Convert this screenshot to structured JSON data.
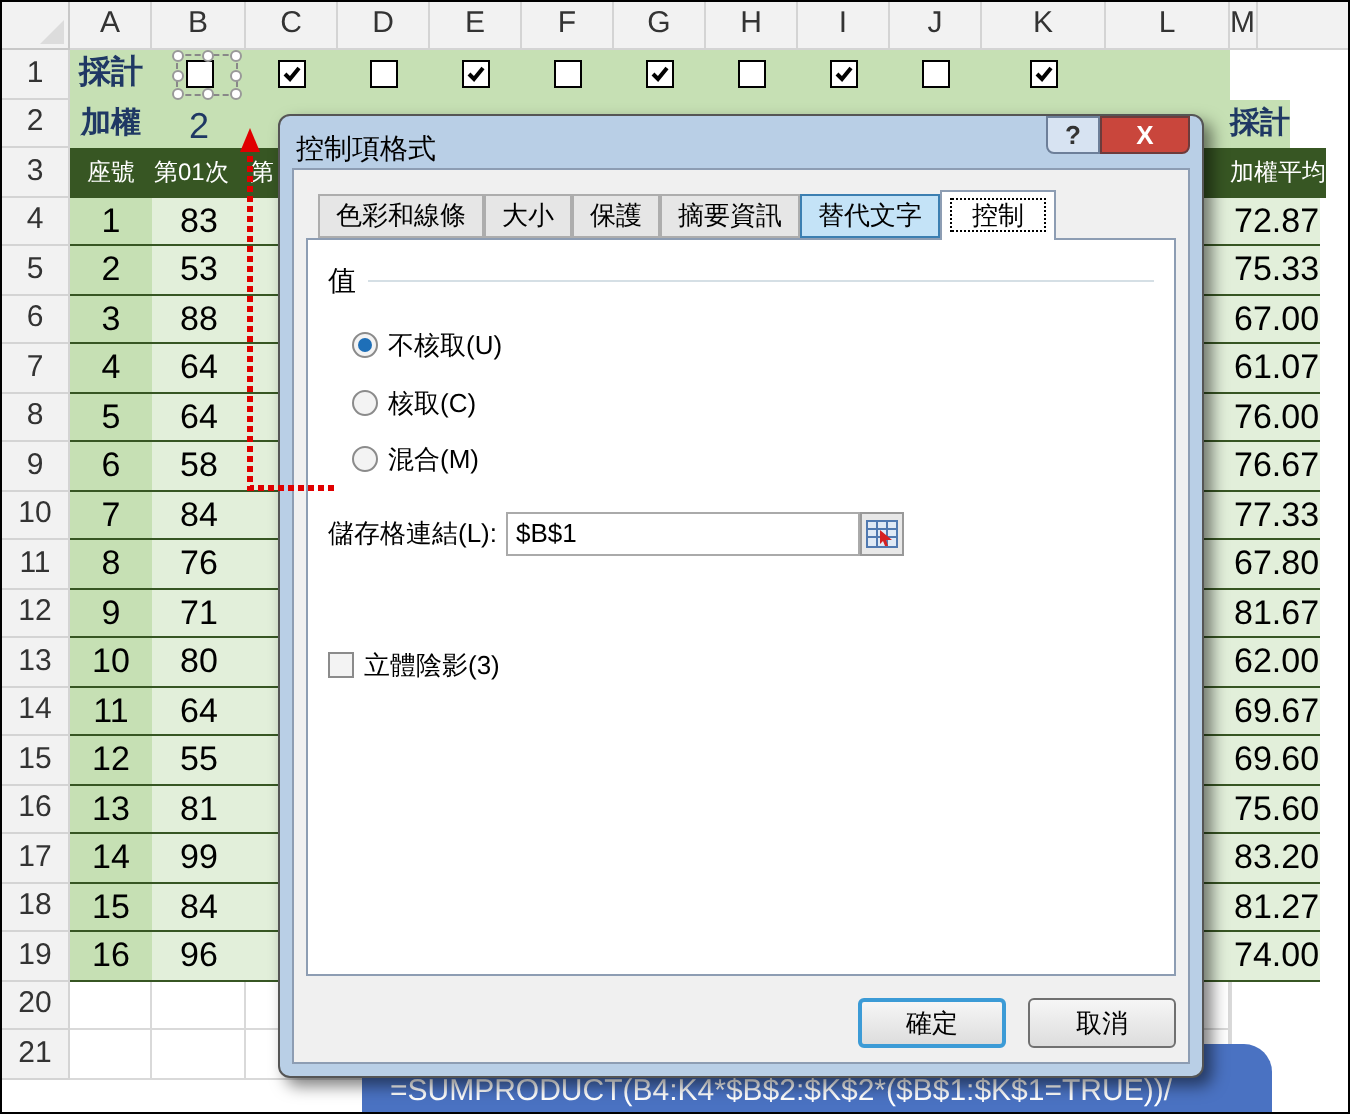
{
  "sheet": {
    "columns": [
      "A",
      "B",
      "C",
      "D",
      "E",
      "F",
      "G",
      "H",
      "I",
      "J",
      "K",
      "L",
      "M"
    ],
    "row_numbers": [
      "1",
      "2",
      "3",
      "4",
      "5",
      "6",
      "7",
      "8",
      "9",
      "10",
      "11",
      "12",
      "13",
      "14",
      "15",
      "16",
      "17",
      "18",
      "19",
      "20",
      "21"
    ],
    "row1_label": "採計",
    "row2_label": "加權",
    "weight": "2",
    "m_label": "採計",
    "checkboxes": [
      {
        "checked": false,
        "selected": true
      },
      {
        "checked": true,
        "selected": false
      },
      {
        "checked": false,
        "selected": false
      },
      {
        "checked": true,
        "selected": false
      },
      {
        "checked": false,
        "selected": false
      },
      {
        "checked": true,
        "selected": false
      },
      {
        "checked": false,
        "selected": false
      },
      {
        "checked": true,
        "selected": false
      },
      {
        "checked": false,
        "selected": false
      },
      {
        "checked": true,
        "selected": false
      }
    ],
    "header": {
      "seat": "座號",
      "first": "第01次",
      "second": "第",
      "average": "加權平均"
    },
    "rows": [
      {
        "seat": "1",
        "score": "83",
        "average": "72.87"
      },
      {
        "seat": "2",
        "score": "53",
        "average": "75.33"
      },
      {
        "seat": "3",
        "score": "88",
        "average": "67.00"
      },
      {
        "seat": "4",
        "score": "64",
        "average": "61.07"
      },
      {
        "seat": "5",
        "score": "64",
        "average": "76.00"
      },
      {
        "seat": "6",
        "score": "58",
        "average": "76.67"
      },
      {
        "seat": "7",
        "score": "84",
        "average": "77.33"
      },
      {
        "seat": "8",
        "score": "76",
        "average": "67.80"
      },
      {
        "seat": "9",
        "score": "71",
        "average": "81.67"
      },
      {
        "seat": "10",
        "score": "80",
        "average": "62.00"
      },
      {
        "seat": "11",
        "score": "64",
        "average": "69.67"
      },
      {
        "seat": "12",
        "score": "55",
        "average": "69.60"
      },
      {
        "seat": "13",
        "score": "81",
        "average": "75.60"
      },
      {
        "seat": "14",
        "score": "99",
        "average": "83.20"
      },
      {
        "seat": "15",
        "score": "84",
        "average": "81.27"
      },
      {
        "seat": "16",
        "score": "96",
        "average": "74.00"
      }
    ]
  },
  "dialog": {
    "title": "控制項格式",
    "help": "?",
    "close": "X",
    "tabs": [
      {
        "label": "色彩和線條",
        "selected": false,
        "hovered": false
      },
      {
        "label": "大小",
        "selected": false,
        "hovered": false
      },
      {
        "label": "保護",
        "selected": false,
        "hovered": false
      },
      {
        "label": "摘要資訊",
        "selected": false,
        "hovered": false
      },
      {
        "label": "替代文字",
        "selected": false,
        "hovered": true
      },
      {
        "label": "控制",
        "selected": true,
        "hovered": false
      }
    ],
    "group_label": "值",
    "radios": [
      {
        "label": "不核取(U)",
        "selected": true
      },
      {
        "label": "核取(C)",
        "selected": false
      },
      {
        "label": "混合(M)",
        "selected": false
      }
    ],
    "cell_link_label": "儲存格連結(L):",
    "cell_link_value": "$B$1",
    "shading": {
      "label": "立體陰影(3)",
      "checked": false
    },
    "buttons": [
      "確定",
      "取消"
    ]
  },
  "formula_callout": "=SUMPRODUCT(B4:K4*$B$2:$K$2*($B$1:$K$1=TRUE))/"
}
